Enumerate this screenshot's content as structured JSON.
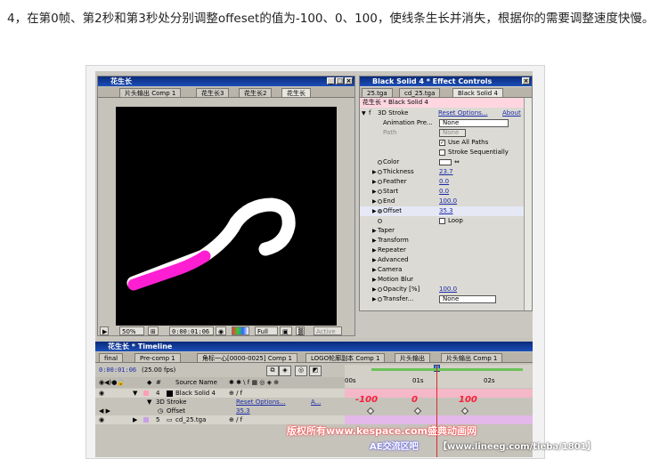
{
  "instruction": "4，在第0帧、第2秒和第3秒处分别调整offeset的值为-100、0、100，使线条生长并消失，根据你的需要调整速度快慢。",
  "comp_window": {
    "title": "花生长",
    "tabs": [
      "片头输出 Comp 1",
      "花生长3",
      "花生长2",
      "花生长"
    ],
    "zoom": "50%",
    "timecode": "0:00:01:06",
    "resolution": "Full",
    "active_label": "Active"
  },
  "effect_controls": {
    "title": "Black Solid 4 * Effect Controls",
    "tabs": [
      "25.tga",
      "cd_25.tga",
      "Black Solid 4"
    ],
    "header": "花生长 * Black Solid 4",
    "effect_name": "3D Stroke",
    "reset_label": "Reset Options...",
    "about_label": "About",
    "rows": [
      {
        "label": "Animation Pre...",
        "value": "None"
      },
      {
        "label": "Path",
        "value": "None"
      },
      {
        "label": "Use All Paths",
        "value": ""
      },
      {
        "label": "Stroke Sequentially",
        "value": ""
      },
      {
        "label": "Color",
        "value": ""
      },
      {
        "label": "Thickness",
        "value": "23.7"
      },
      {
        "label": "Feather",
        "value": "0.0"
      },
      {
        "label": "Start",
        "value": "0.0"
      },
      {
        "label": "End",
        "value": "100.0"
      },
      {
        "label": "Offset",
        "value": "35.3"
      },
      {
        "label": "Loop",
        "value": ""
      },
      {
        "label": "Taper",
        "value": ""
      },
      {
        "label": "Transform",
        "value": ""
      },
      {
        "label": "Repeater",
        "value": ""
      },
      {
        "label": "Advanced",
        "value": ""
      },
      {
        "label": "Camera",
        "value": ""
      },
      {
        "label": "Motion Blur",
        "value": ""
      },
      {
        "label": "Opacity [%]",
        "value": "100.0"
      },
      {
        "label": "Transfer...",
        "value": "None"
      }
    ]
  },
  "timeline": {
    "title": "花生长 * Timeline",
    "tabs": [
      "final",
      "Pre-comp 1",
      "角标一心[0000-0025] Comp 1",
      "LOGO轮廓副本 Comp 1",
      "片头输出",
      "片头输出 Comp 1"
    ],
    "timecode": "0:00:01:06",
    "fps": "(25.00 fps)",
    "col_source": "Source Name",
    "ruler": [
      "00s",
      "01s",
      "02s"
    ],
    "layers": [
      {
        "num": "4",
        "name": "Black Solid 4"
      },
      {
        "num": "",
        "name": "3D Stroke",
        "extra1": "Reset Options...",
        "extra2": "A..."
      },
      {
        "num": "",
        "name": "Offset",
        "value": "35.3"
      },
      {
        "num": "5",
        "name": "cd_25.tga"
      }
    ],
    "annotations": [
      "-100",
      "0",
      "100"
    ]
  },
  "watermarks": {
    "line1": "版权所有www.kespace.com盛典动画网",
    "line2": "AE交流区吧",
    "line3": "【www.lineeg.com/tieba/1801】"
  },
  "colors": {
    "titlebar": "#1c4fb8",
    "stroke_pink": "#ff1fd2",
    "stroke_white": "#ffffff"
  }
}
